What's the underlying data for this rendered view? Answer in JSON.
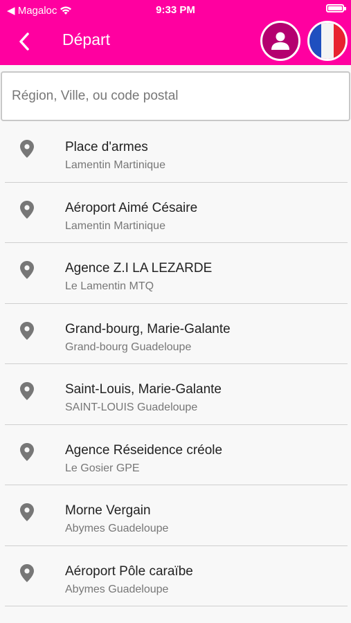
{
  "status_bar": {
    "carrier": "◀ Magaloc",
    "time": "9:33 PM"
  },
  "navbar": {
    "title": "Départ",
    "back_icon": "chevron-left-icon",
    "profile_icon": "user-icon",
    "language_flag": "france-flag",
    "accent_color": "#ff00a0"
  },
  "search": {
    "placeholder": "Région, Ville, ou code postal",
    "value": ""
  },
  "locations": [
    {
      "name": "Place d'armes",
      "subtitle": "Lamentin Martinique"
    },
    {
      "name": "Aéroport Aimé Césaire",
      "subtitle": "Lamentin Martinique"
    },
    {
      "name": "Agence Z.I LA LEZARDE",
      "subtitle": "Le Lamentin MTQ"
    },
    {
      "name": "Grand-bourg, Marie-Galante",
      "subtitle": "Grand-bourg Guadeloupe"
    },
    {
      "name": "Saint-Louis, Marie-Galante",
      "subtitle": "SAINT-LOUIS Guadeloupe"
    },
    {
      "name": "Agence Réseidence créole",
      "subtitle": "Le Gosier GPE"
    },
    {
      "name": "Morne Vergain",
      "subtitle": "Abymes Guadeloupe"
    },
    {
      "name": "Aéroport Pôle caraïbe",
      "subtitle": "Abymes Guadeloupe"
    }
  ]
}
